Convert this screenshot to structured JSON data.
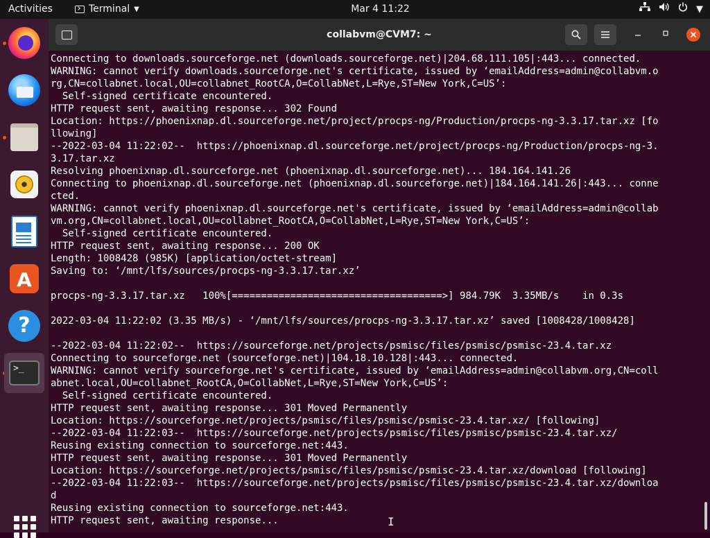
{
  "topbar": {
    "activities": "Activities",
    "app_menu": "Terminal",
    "clock": "Mar 4  11:22",
    "icons": [
      "network-icon",
      "volume-icon",
      "power-icon",
      "chevron-down-icon"
    ]
  },
  "dock": {
    "apps": [
      "Firefox",
      "Thunderbird",
      "Files",
      "Rhythmbox",
      "LibreOffice Writer",
      "Ubuntu Software",
      "Help",
      "Terminal"
    ],
    "terminal_glyph": ">_"
  },
  "window": {
    "title": "collabvm@CVM7: ~"
  },
  "terminal": {
    "lines": [
      "Connecting to downloads.sourceforge.net (downloads.sourceforge.net)|204.68.111.105|:443... connected.",
      "WARNING: cannot verify downloads.sourceforge.net's certificate, issued by ‘emailAddress=admin@collabvm.o",
      "rg,CN=collabnet.local,OU=collabnet_RootCA,O=CollabNet,L=Rye,ST=New York,C=US’:",
      "  Self-signed certificate encountered.",
      "HTTP request sent, awaiting response... 302 Found",
      "Location: https://phoenixnap.dl.sourceforge.net/project/procps-ng/Production/procps-ng-3.3.17.tar.xz [fo",
      "llowing]",
      "--2022-03-04 11:22:02--  https://phoenixnap.dl.sourceforge.net/project/procps-ng/Production/procps-ng-3.",
      "3.17.tar.xz",
      "Resolving phoenixnap.dl.sourceforge.net (phoenixnap.dl.sourceforge.net)... 184.164.141.26",
      "Connecting to phoenixnap.dl.sourceforge.net (phoenixnap.dl.sourceforge.net)|184.164.141.26|:443... conne",
      "cted.",
      "WARNING: cannot verify phoenixnap.dl.sourceforge.net's certificate, issued by ‘emailAddress=admin@collab",
      "vm.org,CN=collabnet.local,OU=collabnet_RootCA,O=CollabNet,L=Rye,ST=New York,C=US’:",
      "  Self-signed certificate encountered.",
      "HTTP request sent, awaiting response... 200 OK",
      "Length: 1008428 (985K) [application/octet-stream]",
      "Saving to: ‘/mnt/lfs/sources/procps-ng-3.3.17.tar.xz’",
      "",
      "procps-ng-3.3.17.tar.xz   100%[====================================>] 984.79K  3.35MB/s    in 0.3s",
      "",
      "2022-03-04 11:22:02 (3.35 MB/s) - ‘/mnt/lfs/sources/procps-ng-3.3.17.tar.xz’ saved [1008428/1008428]",
      "",
      "--2022-03-04 11:22:02--  https://sourceforge.net/projects/psmisc/files/psmisc/psmisc-23.4.tar.xz",
      "Connecting to sourceforge.net (sourceforge.net)|104.18.10.128|:443... connected.",
      "WARNING: cannot verify sourceforge.net's certificate, issued by ‘emailAddress=admin@collabvm.org,CN=coll",
      "abnet.local,OU=collabnet_RootCA,O=CollabNet,L=Rye,ST=New York,C=US’:",
      "  Self-signed certificate encountered.",
      "HTTP request sent, awaiting response... 301 Moved Permanently",
      "Location: https://sourceforge.net/projects/psmisc/files/psmisc/psmisc-23.4.tar.xz/ [following]",
      "--2022-03-04 11:22:03--  https://sourceforge.net/projects/psmisc/files/psmisc/psmisc-23.4.tar.xz/",
      "Reusing existing connection to sourceforge.net:443.",
      "HTTP request sent, awaiting response... 301 Moved Permanently",
      "Location: https://sourceforge.net/projects/psmisc/files/psmisc/psmisc-23.4.tar.xz/download [following]",
      "--2022-03-04 11:22:03--  https://sourceforge.net/projects/psmisc/files/psmisc/psmisc-23.4.tar.xz/downloa",
      "d",
      "Reusing existing connection to sourceforge.net:443.",
      "HTTP request sent, awaiting response..."
    ]
  }
}
